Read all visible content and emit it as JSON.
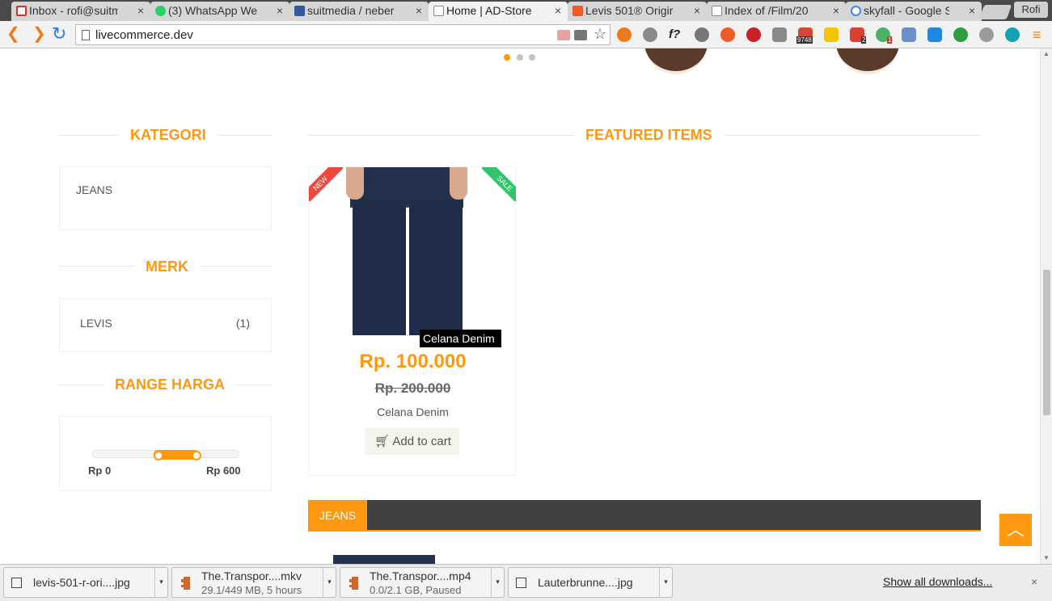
{
  "browser": {
    "tabs": [
      {
        "title": "Inbox - rofi@suitm",
        "favicon": "gmail-icon",
        "color": "#d93025"
      },
      {
        "title": "(3) WhatsApp We",
        "favicon": "whatsapp-icon",
        "color": "#25d366"
      },
      {
        "title": "suitmedia / neber",
        "favicon": "repo-icon",
        "color": "#2f5a9e"
      },
      {
        "title": "Home | AD-Store",
        "favicon": "page-icon",
        "color": "#9a9a9a"
      },
      {
        "title": "Levis 501® Origir",
        "favicon": "levis-icon",
        "color": "#f05a28"
      },
      {
        "title": "Index of /Film/20",
        "favicon": "page-icon",
        "color": "#9a9a9a"
      },
      {
        "title": "skyfall - Google Se",
        "favicon": "google-icon",
        "color": "#4285f4"
      }
    ],
    "tab_close": "×",
    "profile_name": "Rofi",
    "url": "livecommerce.dev",
    "ext_badges": {
      "mail": "9748",
      "todoist": "2",
      "pushbullet": "1"
    }
  },
  "sidebar": {
    "category_title": "KATEGORI",
    "categories": [
      "JEANS"
    ],
    "brand_title": "MERK",
    "brands": [
      {
        "name": "LEVIS",
        "count": "(1)"
      }
    ],
    "price_title": "RANGE HARGA",
    "price_min_label": "Rp 0",
    "price_max_label": "Rp 600"
  },
  "featured": {
    "title": "FEATURED ITEMS",
    "product": {
      "badge_new": "NEW",
      "badge_sale": "SALE",
      "image_caption": "Celana Denim",
      "price": "Rp. 100.000",
      "old_price": "Rp. 200.000",
      "name": "Celana Denim",
      "add_to_cart": "Add to cart"
    }
  },
  "category_tabs": {
    "active": "JEANS"
  },
  "scroll_top_icon": "chevron-up-icon",
  "downloads": {
    "items": [
      {
        "name": "levis-501-r-ori....jpg",
        "status": ""
      },
      {
        "name": "The.Transpor....mkv",
        "status": "29.1/449 MB, 5 hours"
      },
      {
        "name": "The.Transpor....mp4",
        "status": "0.0/2.1 GB, Paused"
      },
      {
        "name": "Lauterbrunne....jpg",
        "status": ""
      }
    ],
    "show_all": "Show all downloads...",
    "close": "×"
  },
  "colors": {
    "accent": "#fe980f",
    "dark_bar": "#40403e",
    "new_ribbon": "#f0483e",
    "sale_ribbon": "#33c36a"
  }
}
